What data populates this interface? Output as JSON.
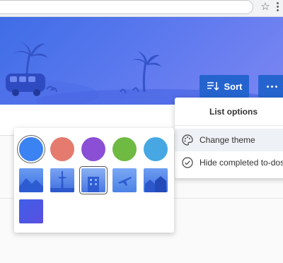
{
  "toolbar": {
    "sort_label": "Sort"
  },
  "list_options": {
    "title": "List options",
    "items": [
      {
        "label": "Change theme",
        "icon": "palette-icon"
      },
      {
        "label": "Hide completed to-dos",
        "icon": "check-circle-icon"
      }
    ]
  },
  "theme_picker": {
    "colors": [
      "#3b82f2",
      "#e57a6f",
      "#8a4fd4",
      "#6fba43",
      "#46a7e3"
    ],
    "selected_color_index": 0,
    "images": [
      "mountains",
      "space-needle",
      "building",
      "airplane",
      "houses",
      "blue-gradient"
    ],
    "selected_image_index": 2
  },
  "colors": {
    "accent": "#2564cf",
    "banner_start": "#3f6de6",
    "banner_end": "#7c86f2"
  }
}
